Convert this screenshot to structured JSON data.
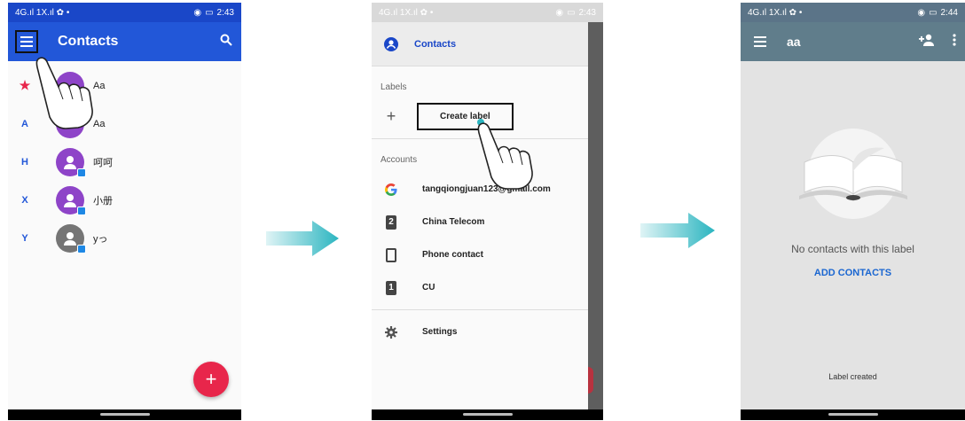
{
  "screen1": {
    "status": {
      "left": "4G.ıl 1X.ıl ✿ •",
      "time": "2:43"
    },
    "title": "Contacts",
    "contacts": [
      {
        "index": "★",
        "name": "Aa"
      },
      {
        "index": "A",
        "name": "Aa"
      },
      {
        "index": "H",
        "name": "呵呵"
      },
      {
        "index": "X",
        "name": "小册"
      },
      {
        "index": "Y",
        "name": "yっ"
      }
    ],
    "fab_label": "+"
  },
  "screen2": {
    "status": {
      "left": "4G.ıl 1X.ıl ✿ •",
      "time": "2:43"
    },
    "header_label": "Contacts",
    "labels_section": "Labels",
    "create_label": "Create label",
    "accounts_section": "Accounts",
    "accounts": [
      {
        "icon": "google-icon",
        "label": "tangqiongjuan123@gmail.com"
      },
      {
        "icon": "sim2-icon",
        "label": "China Telecom"
      },
      {
        "icon": "phone-icon",
        "label": "Phone contact"
      },
      {
        "icon": "sim1-icon",
        "label": "CU"
      }
    ],
    "settings_label": "Settings"
  },
  "screen3": {
    "status": {
      "left": "4G.ıl 1X.ıl ✿ •",
      "time": "2:44"
    },
    "title": "aa",
    "empty_message": "No contacts with this label",
    "add_contacts": "ADD CONTACTS",
    "toast": "Label created"
  },
  "colors": {
    "contacts_blue": "#2257d8",
    "label_grey": "#607d8b",
    "fab_red": "#e8264b",
    "arrow_teal": "#2bb5c0",
    "avatar_purple": "#8e44c8"
  },
  "sim_numbers": {
    "sim2": "2",
    "sim1": "1"
  }
}
